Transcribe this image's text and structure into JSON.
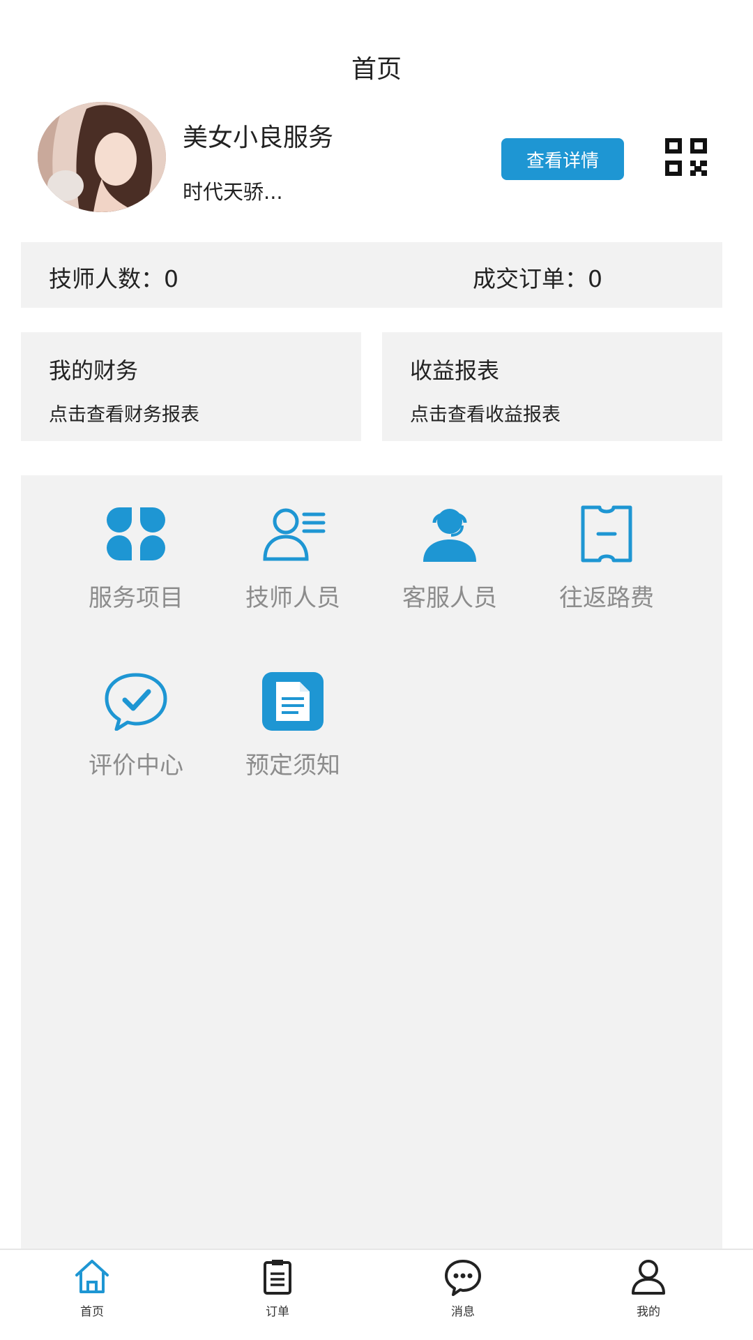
{
  "header": {
    "title": "首页"
  },
  "profile": {
    "name": "美女小良服务",
    "subtitle": "时代天骄...",
    "detail_button": "查看详情",
    "qr_icon": "qr-code-icon"
  },
  "stats": {
    "technicians": "技师人数：0",
    "orders": "成交订单：0"
  },
  "cards": [
    {
      "title": "我的财务",
      "subtitle": "点击查看财务报表"
    },
    {
      "title": "收益报表",
      "subtitle": "点击查看收益报表"
    }
  ],
  "menu": [
    {
      "label": "服务项目",
      "icon": "clover-icon"
    },
    {
      "label": "技师人员",
      "icon": "staff-list-icon"
    },
    {
      "label": "客服人员",
      "icon": "headset-agent-icon"
    },
    {
      "label": "往返路费",
      "icon": "ticket-icon"
    },
    {
      "label": "评价中心",
      "icon": "check-chat-icon"
    },
    {
      "label": "预定须知",
      "icon": "document-icon"
    }
  ],
  "tabbar": {
    "items": [
      {
        "label": "首页",
        "icon": "home-icon",
        "active": true
      },
      {
        "label": "订单",
        "icon": "clipboard-icon",
        "active": false
      },
      {
        "label": "消息",
        "icon": "chat-icon",
        "active": false
      },
      {
        "label": "我的",
        "icon": "user-icon",
        "active": false
      }
    ]
  },
  "colors": {
    "accent": "#1e96d3",
    "panel": "#f2f2f2",
    "muted_text": "#8c8c8c"
  }
}
